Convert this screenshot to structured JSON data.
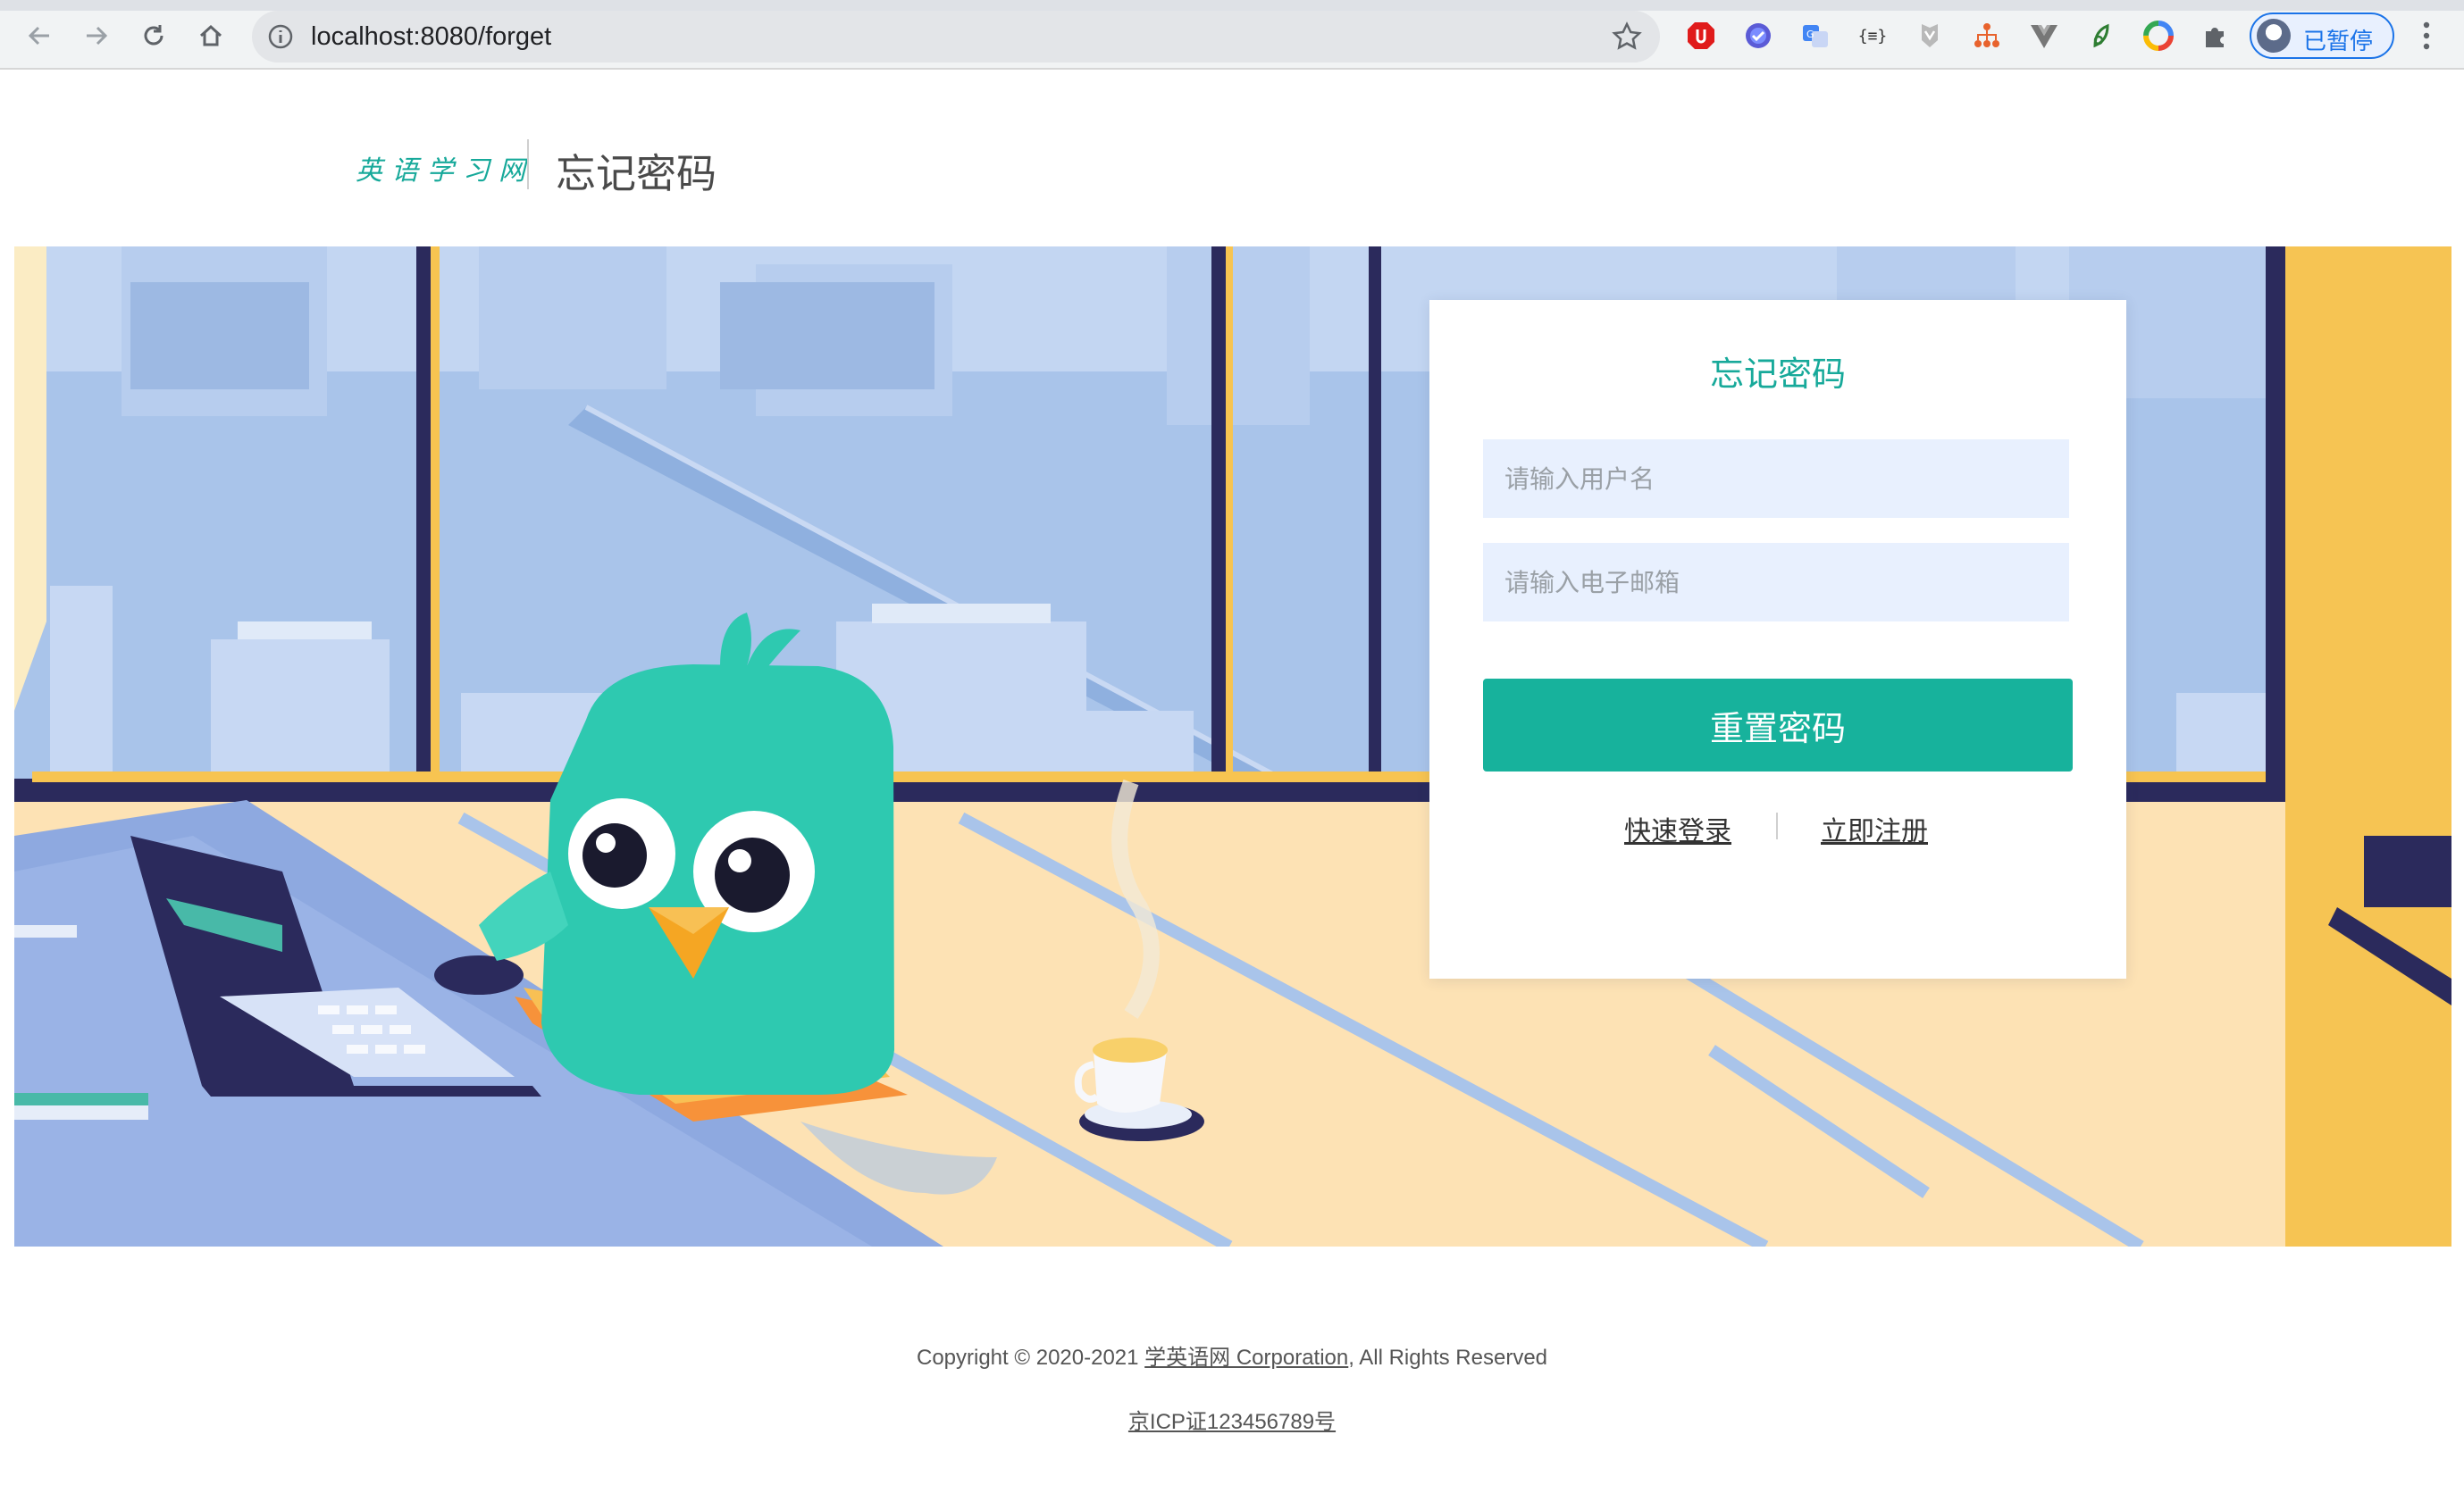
{
  "browser": {
    "url": "localhost:8080/forget",
    "profile_label": "已暂停",
    "extensions": [
      "ublock-icon",
      "verified-check-icon",
      "translate-icon",
      "json-viewer-icon",
      "shield-extension-icon",
      "sitemap-icon",
      "vue-devtools-icon",
      "leaf-extension-icon",
      "color-picker-icon",
      "puzzle-extensions-icon"
    ],
    "json_ext_label": "{≡}"
  },
  "header": {
    "logo_text": "英语学习网",
    "title": "忘记密码"
  },
  "form": {
    "title": "忘记密码",
    "username_placeholder": "请输入用户名",
    "email_placeholder": "请输入电子邮箱",
    "submit_label": "重置密码",
    "login_link": "快速登录",
    "register_link": "立即注册"
  },
  "footer": {
    "copyright_prefix": "Copyright © 2020-2021 ",
    "company": "学英语网 Corporation",
    "copyright_suffix": ", All Rights Reserved",
    "icp": "京ICP证123456789号"
  },
  "colors": {
    "accent": "#17a99a",
    "button": "#17b29c",
    "input_bg": "#e8f0fe",
    "sky": "#a9c4ea",
    "floor": "#fde2b4",
    "frame_yellow": "#f7c451",
    "frame_dark": "#2b2a5c",
    "bird": "#2ec9b0"
  }
}
